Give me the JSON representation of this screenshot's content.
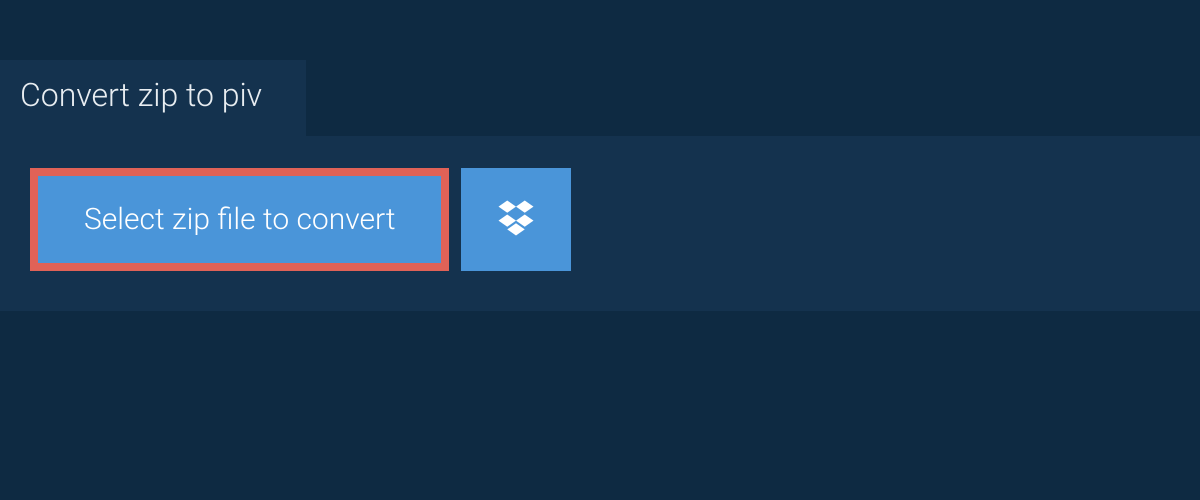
{
  "tab": {
    "title": "Convert zip to piv"
  },
  "actions": {
    "select_file_label": "Select zip file to convert"
  }
}
